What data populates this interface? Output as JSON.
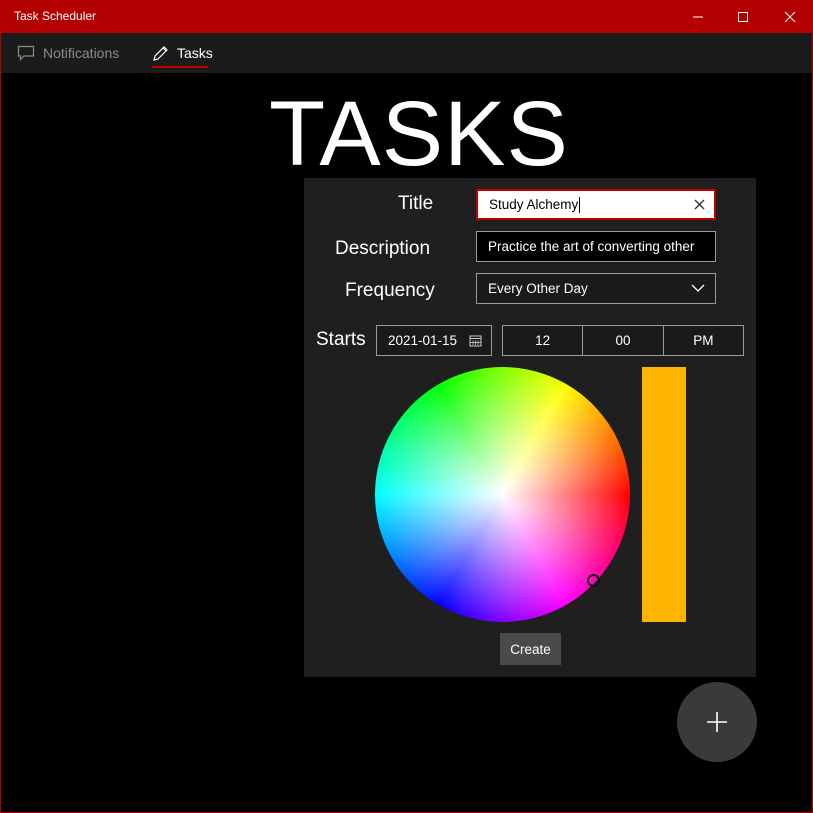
{
  "window": {
    "title": "Task Scheduler",
    "accent_color": "#b30000",
    "controls": [
      "minimize-icon",
      "maximize-icon",
      "close-icon"
    ]
  },
  "nav": {
    "tabs": [
      {
        "label": "Notifications",
        "icon": "chat-bubble-icon",
        "selected": false
      },
      {
        "label": "Tasks",
        "icon": "pencil-icon",
        "selected": true
      }
    ]
  },
  "page": {
    "heading": "TASKS"
  },
  "form": {
    "title_label": "Title",
    "title_value": "Study Alchemy",
    "description_label": "Description",
    "description_value": "Practice the art of converting other",
    "frequency_label": "Frequency",
    "frequency_value": "Every Other Day",
    "starts_label": "Starts",
    "start_date": "2021-01-15",
    "start_hour": "12",
    "start_minute": "00",
    "start_period": "PM",
    "selected_color": "#ffb400",
    "create_label": "Create"
  },
  "fab": {
    "icon": "plus-icon"
  }
}
